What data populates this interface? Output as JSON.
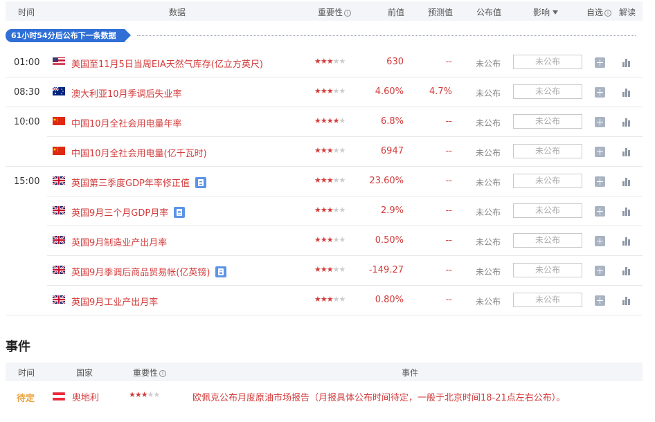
{
  "header": {
    "time": "时间",
    "data": "数据",
    "importance": "重要性",
    "previous": "前值",
    "forecast": "预测值",
    "published": "公布值",
    "impact": "影响",
    "watchlist": "自选",
    "interpret": "解读"
  },
  "countdown": "61小时54分后公布下一条数据",
  "rows": [
    {
      "time": "01:00",
      "flag": "us",
      "name": "美国至11月5日当周EIA天然气库存(亿立方英尺)",
      "has_doc": false,
      "stars": 3,
      "previous": "630",
      "forecast": "--",
      "published": "未公布",
      "impact": "未公布"
    },
    {
      "time": "08:30",
      "flag": "au",
      "name": "澳大利亚10月季调后失业率",
      "has_doc": false,
      "stars": 3,
      "previous": "4.60%",
      "forecast": "4.7%",
      "published": "未公布",
      "impact": "未公布"
    },
    {
      "time": "10:00",
      "flag": "cn",
      "name": "中国10月全社会用电量年率",
      "has_doc": false,
      "stars": 4,
      "previous": "6.8%",
      "forecast": "--",
      "published": "未公布",
      "impact": "未公布"
    },
    {
      "time": "",
      "flag": "cn",
      "name": "中国10月全社会用电量(亿千瓦时)",
      "has_doc": false,
      "stars": 3,
      "previous": "6947",
      "forecast": "--",
      "published": "未公布",
      "impact": "未公布"
    },
    {
      "time": "15:00",
      "flag": "gb",
      "name": "英国第三季度GDP年率修正值",
      "has_doc": true,
      "stars": 3,
      "previous": "23.60%",
      "forecast": "--",
      "published": "未公布",
      "impact": "未公布"
    },
    {
      "time": "",
      "flag": "gb",
      "name": "英国9月三个月GDP月率",
      "has_doc": true,
      "stars": 3,
      "previous": "2.9%",
      "forecast": "--",
      "published": "未公布",
      "impact": "未公布"
    },
    {
      "time": "",
      "flag": "gb",
      "name": "英国9月制造业产出月率",
      "has_doc": false,
      "stars": 3,
      "previous": "0.50%",
      "forecast": "--",
      "published": "未公布",
      "impact": "未公布"
    },
    {
      "time": "",
      "flag": "gb",
      "name": "英国9月季调后商品贸易帐(亿英镑)",
      "has_doc": true,
      "stars": 3,
      "previous": "-149.27",
      "forecast": "--",
      "published": "未公布",
      "impact": "未公布"
    },
    {
      "time": "",
      "flag": "gb",
      "name": "英国9月工业产出月率",
      "has_doc": false,
      "stars": 3,
      "previous": "0.80%",
      "forecast": "--",
      "published": "未公布",
      "impact": "未公布"
    }
  ],
  "events": {
    "title": "事件",
    "header": {
      "time": "时间",
      "country": "国家",
      "importance": "重要性",
      "event": "事件"
    },
    "rows": [
      {
        "status": "待定",
        "flag": "at",
        "country": "奥地利",
        "stars": 3,
        "event": "欧佩克公布月度原油市场报告（月报具体公布时间待定，一般于北京时间18-21点左右公布）。"
      }
    ]
  },
  "colors": {
    "accent_red": "#d33b3b",
    "blue_banner": "#2f6fd6",
    "pending_orange": "#e8a33b"
  }
}
